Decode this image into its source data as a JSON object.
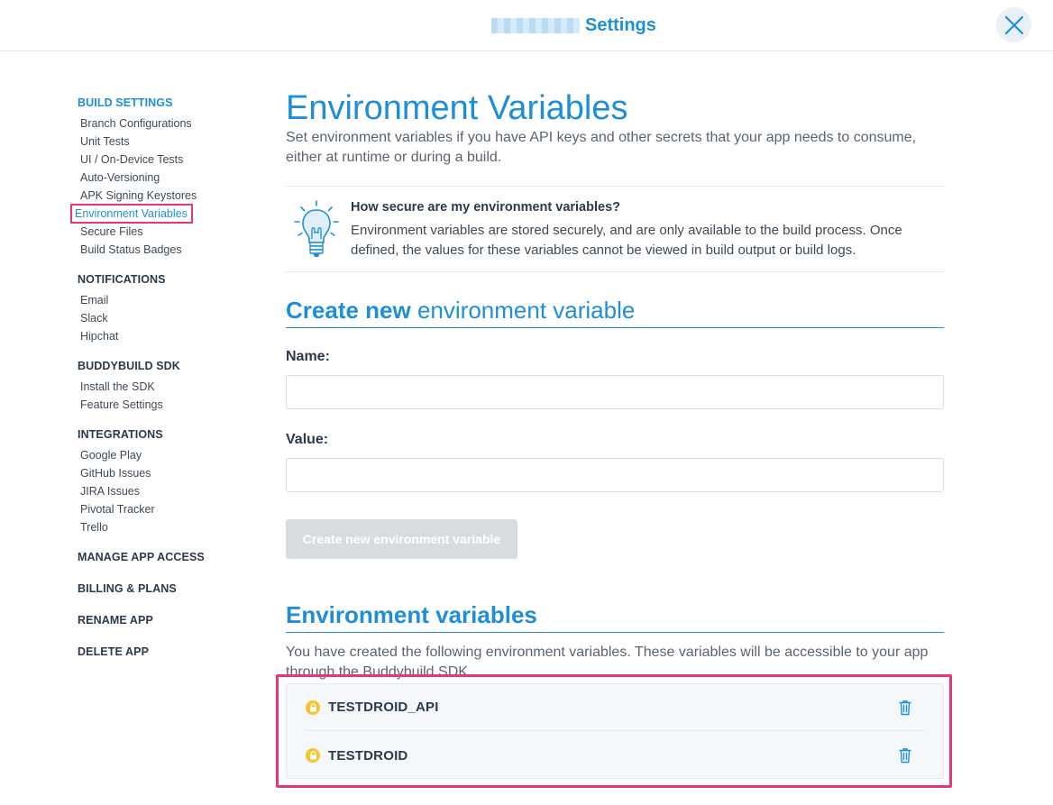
{
  "header": {
    "title": "Settings",
    "close_icon": "close-icon"
  },
  "sidebar": {
    "groups": [
      {
        "heading": "BUILD SETTINGS",
        "items": [
          "Branch Configurations",
          "Unit Tests",
          "UI / On-Device Tests",
          "Auto-Versioning",
          "APK Signing Keystores",
          "Environment Variables",
          "Secure Files",
          "Build Status Badges"
        ]
      },
      {
        "heading": "NOTIFICATIONS",
        "items": [
          "Email",
          "Slack",
          "Hipchat"
        ]
      },
      {
        "heading": "BUDDYBUILD SDK",
        "items": [
          "Install the SDK",
          "Feature Settings"
        ]
      },
      {
        "heading": "INTEGRATIONS",
        "items": [
          "Google Play",
          "GitHub Issues",
          "JIRA Issues",
          "Pivotal Tracker",
          "Trello"
        ]
      },
      {
        "heading": "MANAGE APP ACCESS",
        "items": []
      },
      {
        "heading": "BILLING & PLANS",
        "items": []
      },
      {
        "heading": "RENAME APP",
        "items": []
      },
      {
        "heading": "DELETE APP",
        "items": []
      }
    ],
    "active_item": "Environment Variables"
  },
  "main": {
    "title": "Environment Variables",
    "description": "Set environment variables if you have API keys and other secrets that your app needs to consume, either at runtime or during a build.",
    "info": {
      "icon": "lightbulb-icon",
      "title": "How secure are my environment variables?",
      "text": "Environment variables are stored securely, and are only available to the build process. Once defined, the values for these variables cannot be viewed in build output or build logs."
    },
    "create": {
      "title_bold": "Create new",
      "title_light": "environment variable",
      "name_label": "Name:",
      "name_value": "",
      "value_label": "Value:",
      "value_value": "",
      "button_label": "Create new environment variable"
    },
    "list": {
      "title": "Environment variables",
      "description": "You have created the following environment variables. These variables will be accessible to your app through the Buddybuild SDK.",
      "variables": [
        {
          "name": "TESTDROID_API",
          "icon": "lock-icon",
          "action_icon": "trash-icon"
        },
        {
          "name": "TESTDROID",
          "icon": "lock-icon",
          "action_icon": "trash-icon"
        }
      ]
    }
  },
  "colors": {
    "accent": "#1e8fd6",
    "highlight": "#e8367a",
    "lock": "#f6c42b",
    "button_disabled": "#d9dcdf"
  }
}
